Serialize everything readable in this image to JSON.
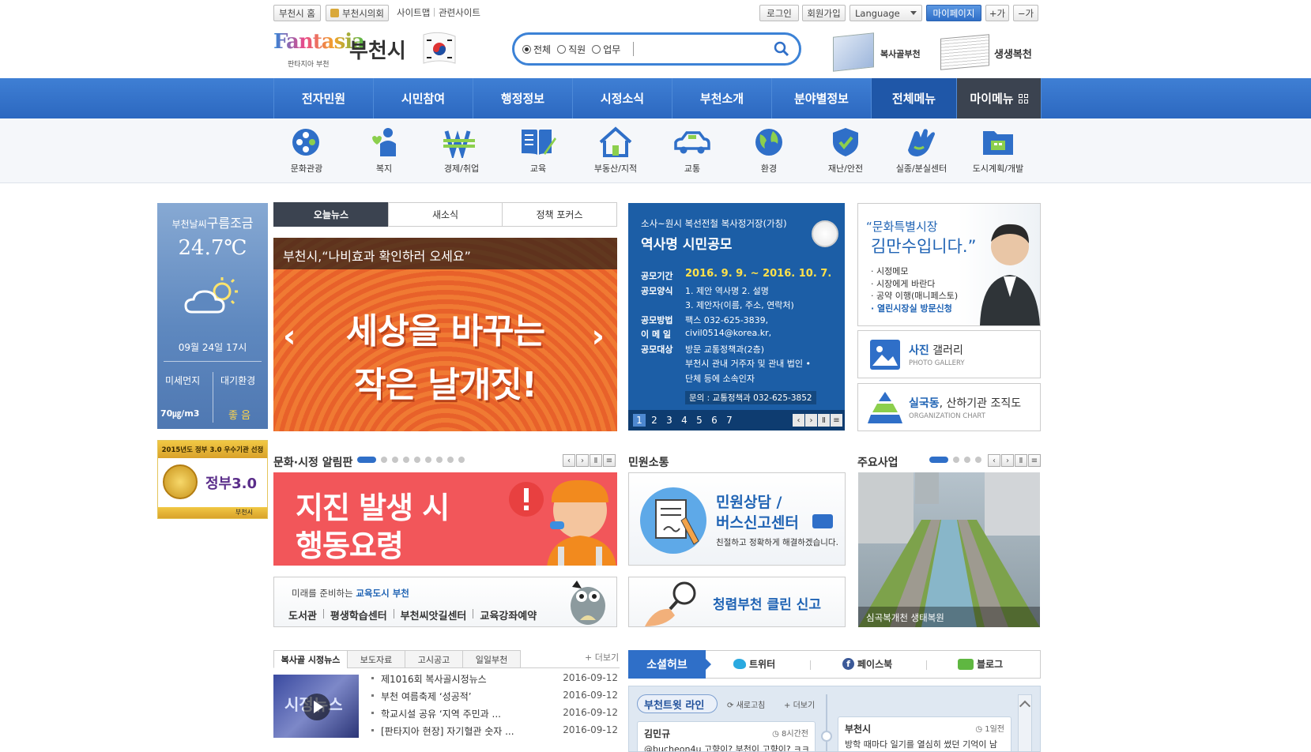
{
  "top": {
    "home": "부천시 홈",
    "council": "부천시의회",
    "sitemap": "사이트맵",
    "related": "관련사이트",
    "login": "로그인",
    "join": "회원가입",
    "language": "Language",
    "mypage": "마이페이지",
    "font_up": "+가",
    "font_down": "−가"
  },
  "logo": {
    "brand": "Fantasia",
    "sub": "판타지아 부천",
    "city": "부천시"
  },
  "search": {
    "options": [
      "전체",
      "직원",
      "업무"
    ],
    "placeholder": ""
  },
  "banners": {
    "left": "복사골부천",
    "right": "생생복천"
  },
  "nav": [
    "전자민원",
    "시민참여",
    "행정정보",
    "시정소식",
    "부천소개",
    "분야별정보",
    "전체메뉴",
    "마이메뉴"
  ],
  "quick": [
    "문화관광",
    "복지",
    "경제/취업",
    "교육",
    "부동산/지적",
    "교통",
    "환경",
    "재난/안전",
    "실종/분실센터",
    "도시계획/개발"
  ],
  "weather": {
    "title_a": "부천날씨",
    "title_b": "구름조금",
    "temp": "24.7℃",
    "date": "09월 24일 17시",
    "dust_label": "미세먼지",
    "air_label": "대기환경",
    "dust_value": "70㎍/m3",
    "air_value": "좋 음"
  },
  "gov": {
    "title": "2015년도 정부 3.0 우수기관 선정",
    "label": "정부3.0",
    "badge": "부천시"
  },
  "news": {
    "tabs": [
      "오늘뉴스",
      "새소식",
      "정책 포커스"
    ],
    "headline": "부천시,“나비효과 확인하러 오세요”",
    "line1": "세상을 바꾸는",
    "line2": "작은 날개짓!"
  },
  "contest": {
    "sub": "소사~원시 복선전철 복사정거장(가칭)",
    "title": "역사명 시민공모",
    "rows": [
      {
        "k": "공모기간",
        "v": "2016. 9. 9. ~ 2016. 10. 7."
      },
      {
        "k": "공모양식",
        "v": "1. 제안 역사명  2. 설명"
      },
      {
        "k": "",
        "v": "3. 제안자(이름, 주소, 연락처)"
      },
      {
        "k": "공모방법",
        "v": "팩스 032-625-3839,"
      },
      {
        "k": "이 메 일",
        "v": "civil0514@korea.kr,"
      },
      {
        "k": "공모대상",
        "v": "방문 교통정책과(2층)"
      },
      {
        "k": "",
        "v": "부천시 관내 거주자 및 관내 법인 •"
      },
      {
        "k": "",
        "v": "단체 등에 소속인자"
      }
    ],
    "contact": "문의 : 교통정책과 032-625-3852",
    "pages": [
      "1",
      "2",
      "3",
      "4",
      "5",
      "6",
      "7"
    ]
  },
  "mayor": {
    "quote1": "“문화특별시장",
    "quote2": "김만수입니다.”",
    "links": [
      "시정메모",
      "시장에게 바란다",
      "공약 이행(매니페스토)",
      "열린시장실 방문신청"
    ]
  },
  "gallery": {
    "title_a": "사진",
    "title_b": " 갤러리",
    "sub": "PHOTO GALLERY"
  },
  "org": {
    "title_a": "실국동",
    "title_b": ", 산하기관 조직도",
    "sub": "ORGANIZATION CHART"
  },
  "board": {
    "title": "문화·시정 알림판",
    "line1": "지진 발생 시",
    "line2": "행동요령"
  },
  "civil": {
    "title": "민원소통",
    "line1": "민원상담 /",
    "line2": "버스신고센터",
    "desc": "친절하고 정확하게 해결하겠습니다."
  },
  "major": {
    "title": "주요사업",
    "caption": "심곡복개천 생태복원"
  },
  "edu": {
    "pre": "미래를 준비하는",
    "hl": "교육도시 부천",
    "links": [
      "도서관",
      "평생학습센터",
      "부천씨앗길센터",
      "교육강좌예약"
    ]
  },
  "clean": {
    "text": "청렴부천 클린 신고"
  },
  "pressTabs": [
    "복사골 시정뉴스",
    "보도자료",
    "고시공고",
    "일일부천"
  ],
  "more": "더보기",
  "videoLabel": "시정뉴스",
  "newsList": [
    {
      "t": "제1016회 복사골시정뉴스",
      "d": "2016-09-12"
    },
    {
      "t": "부천 여름축제 ‘성공적’",
      "d": "2016-09-12"
    },
    {
      "t": "학교시설 공유 ‘지역 주민과 ...",
      "d": "2016-09-12"
    },
    {
      "t": "[판타지아 현장] 자기혈관 숫자 ...",
      "d": "2016-09-12"
    }
  ],
  "social": {
    "title": "소셜허브",
    "tabs": [
      "트위터",
      "페이스북",
      "블로그"
    ],
    "line": "부천트윗 라인",
    "refresh": "새로고침",
    "more": "더보기",
    "post1": {
      "name": "김민규",
      "time": "8시간전",
      "text": "@bucheon4u 고향이? 부천이 고향이? ㅋㅋ"
    },
    "post2": {
      "name": "부천시",
      "time": "1일전",
      "text": "방학 때마다 일기를 열심히 썼던 기억이 남"
    }
  },
  "colors": {
    "nav": "#2f6dc4",
    "accent": "#1e5fb4",
    "orange": "#ee6a2a",
    "red": "#f2565a"
  }
}
